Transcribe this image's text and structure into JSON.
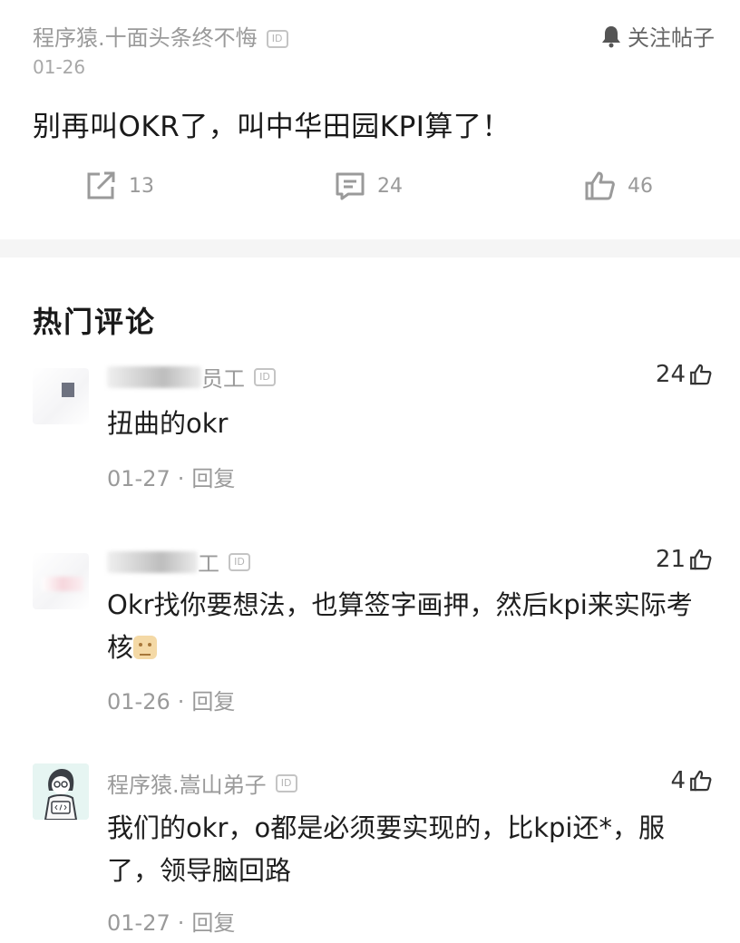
{
  "post": {
    "author": "程序猿.十面头条终不悔",
    "date": "01-26",
    "follow_label": "关注帖子",
    "content": "别再叫OKR了，叫中华田园KPI算了！",
    "share_count": "13",
    "comment_count": "24",
    "like_count": "46"
  },
  "section_title": "热门评论",
  "comments": [
    {
      "name_visible": "员工",
      "text": "扭曲的okr",
      "date": "01-27",
      "reply_label": "回复",
      "likes": "24"
    },
    {
      "name_visible": "工",
      "text": "Okr找你要想法，也算签字画押，然后kpi来实际考核",
      "date": "01-26",
      "reply_label": "回复",
      "likes": "21"
    },
    {
      "name_visible": "程序猿.嵩山弟子",
      "text": "我们的okr，o都是必须要实现的，比kpi还*，服了，领导脑回路",
      "date": "01-27",
      "reply_label": "回复",
      "likes": "4"
    }
  ],
  "icons": {
    "bell": "bell-icon",
    "share": "share-icon",
    "comment": "comment-icon",
    "like": "thumbs-up-icon",
    "id_badge": "id-badge-icon"
  }
}
